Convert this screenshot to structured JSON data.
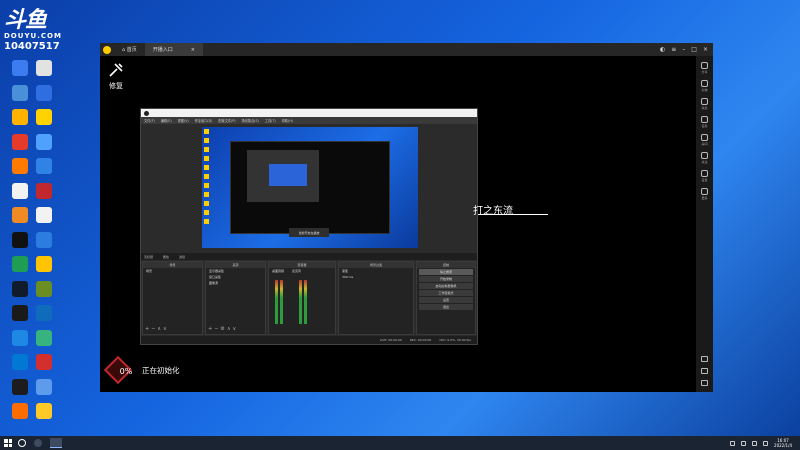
{
  "watermark": {
    "logo": "斗鱼",
    "sub": "DOUYU.COM",
    "room": "10407517"
  },
  "desktop_icons": [
    {
      "label": "",
      "color": "#3d7cf0"
    },
    {
      "label": "",
      "color": "#e2e2e2"
    },
    {
      "label": "",
      "color": "#4a90d9"
    },
    {
      "label": "",
      "color": "#2f6ee0"
    },
    {
      "label": "",
      "color": "#ffb300"
    },
    {
      "label": "",
      "color": "#ffd200"
    },
    {
      "label": "",
      "color": "#e63a2a"
    },
    {
      "label": "",
      "color": "#4fa1ff"
    },
    {
      "label": "",
      "color": "#ff7a00"
    },
    {
      "label": "",
      "color": "#2f83e6"
    },
    {
      "label": "",
      "color": "#f2f2f2"
    },
    {
      "label": "",
      "color": "#c0282d"
    },
    {
      "label": "",
      "color": "#f08a24"
    },
    {
      "label": "",
      "color": "#f2f2f2"
    },
    {
      "label": "",
      "color": "#111111"
    },
    {
      "label": "",
      "color": "#2b7de0"
    },
    {
      "label": "",
      "color": "#1f9d55"
    },
    {
      "label": "",
      "color": "#ffc400"
    },
    {
      "label": "",
      "color": "#101c2c"
    },
    {
      "label": "",
      "color": "#6b8e23"
    },
    {
      "label": "",
      "color": "#1a1a1a"
    },
    {
      "label": "",
      "color": "#0f6cbd"
    },
    {
      "label": "",
      "color": "#1e88e5"
    },
    {
      "label": "",
      "color": "#36b37e"
    },
    {
      "label": "",
      "color": "#0078d4"
    },
    {
      "label": "",
      "color": "#d32f2f"
    },
    {
      "label": "",
      "color": "#1c1c1c"
    },
    {
      "label": "",
      "color": "#5d9cec"
    },
    {
      "label": "",
      "color": "#ff6d00"
    },
    {
      "label": "",
      "color": "#ffca28"
    }
  ],
  "app": {
    "tabs": [
      {
        "label": "首页"
      },
      {
        "label": "开播入口"
      }
    ],
    "repair_label": "修复",
    "danmaku": "打之东流",
    "init_percent": "0%",
    "init_text": "正在初始化",
    "rail": [
      "分享",
      "礼物",
      "消息",
      "任务",
      "房间",
      "关注",
      "设置",
      "更多"
    ]
  },
  "obs": {
    "menu": [
      "文件(F)",
      "编辑(E)",
      "视图(V)",
      "停靠窗口(D)",
      "配置文件(P)",
      "场景集合(S)",
      "工具(T)",
      "帮助(H)"
    ],
    "preview_tip": "当前开启在播放",
    "bar_items": [
      "无标题",
      "属性",
      "滤镜"
    ],
    "scenes": {
      "header": "场景",
      "items": [
        "场景"
      ]
    },
    "sources": {
      "header": "来源",
      "items": [
        "显示器采集",
        "窗口采集",
        "图像源"
      ]
    },
    "mixer": {
      "header": "混音器",
      "channels": [
        "桌面音频",
        "麦克风"
      ]
    },
    "transitions": {
      "header": "场景过渡",
      "items": [
        "渐变",
        "300 ms"
      ]
    },
    "controls": {
      "header": "控制",
      "buttons": [
        "停止推流",
        "开始录制",
        "启动虚拟摄像机",
        "工作室模式",
        "设置",
        "退出"
      ]
    },
    "status": [
      "LIVE: 00:00:00",
      "REC: 00:00:00",
      "CPU: 0.0%, 30.00 fps"
    ]
  },
  "taskbar": {
    "time": "16:07",
    "date": "2022/1/4"
  }
}
